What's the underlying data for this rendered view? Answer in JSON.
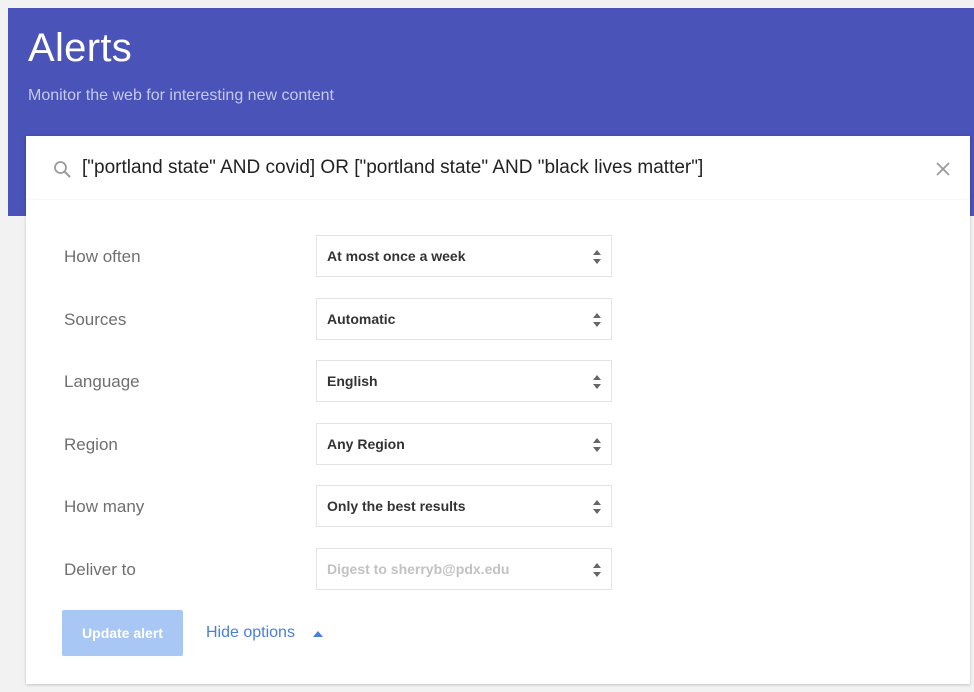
{
  "header": {
    "title": "Alerts",
    "subtitle": "Monitor the web for interesting new content",
    "background_color": "#4a53b8"
  },
  "search": {
    "value": "[\"portland state\" AND covid] OR [\"portland state\" AND \"black lives matter\"]",
    "icon": "search-icon",
    "clear_icon": "close-icon"
  },
  "options": [
    {
      "label": "How often",
      "value": "At most once a week",
      "disabled": false
    },
    {
      "label": "Sources",
      "value": "Automatic",
      "disabled": false
    },
    {
      "label": "Language",
      "value": "English",
      "disabled": false
    },
    {
      "label": "Region",
      "value": "Any Region",
      "disabled": false
    },
    {
      "label": "How many",
      "value": "Only the best results",
      "disabled": false
    },
    {
      "label": "Deliver to",
      "value": "Digest to sherryb@pdx.edu",
      "disabled": true
    }
  ],
  "actions": {
    "update_label": "Update alert",
    "update_disabled": true,
    "hide_options_label": "Hide options",
    "accent_color": "#4a7fd8"
  }
}
